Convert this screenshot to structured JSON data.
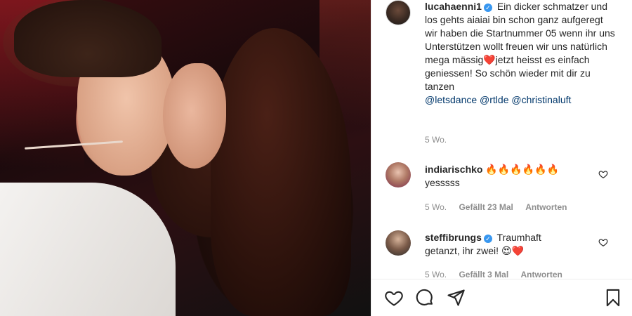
{
  "post": {
    "owner": {
      "username": "lucahaenni1",
      "caption": "Ein dicker schmatzer und los gehts aiaiai bin schon ganz aufgeregt ⁣⁣wir haben die Startnummer 05 wenn ihr uns Unterstützen wollt freuen wir uns natürlich mega mässig❤️jetzt heisst es einfach geniessen! So schön wieder mit dir zu tanzen",
      "mentions": "@letsdance @rtlde @christinaluft",
      "time": "5 Wo."
    },
    "comments": [
      {
        "username": "indiarischko",
        "text": "🔥🔥🔥🔥🔥🔥",
        "text2": "yesssss",
        "time": "5 Wo.",
        "likes": "Gefällt 23 Mal",
        "reply": "Antworten"
      },
      {
        "username": "steffibrungs",
        "text": "Traumhaft",
        "text2": "getanzt, ihr zwei! 😍❤️",
        "time": "5 Wo.",
        "likes": "Gefällt 3 Mal",
        "reply": "Antworten"
      }
    ]
  },
  "icons": {
    "like": "heart-icon",
    "comment": "comment-icon",
    "share": "paper-plane-icon",
    "save": "bookmark-icon",
    "verified": "verified-badge-icon"
  },
  "colors": {
    "verified": "#3897f0",
    "mention": "#00376b",
    "meta": "#8e8e8e"
  }
}
